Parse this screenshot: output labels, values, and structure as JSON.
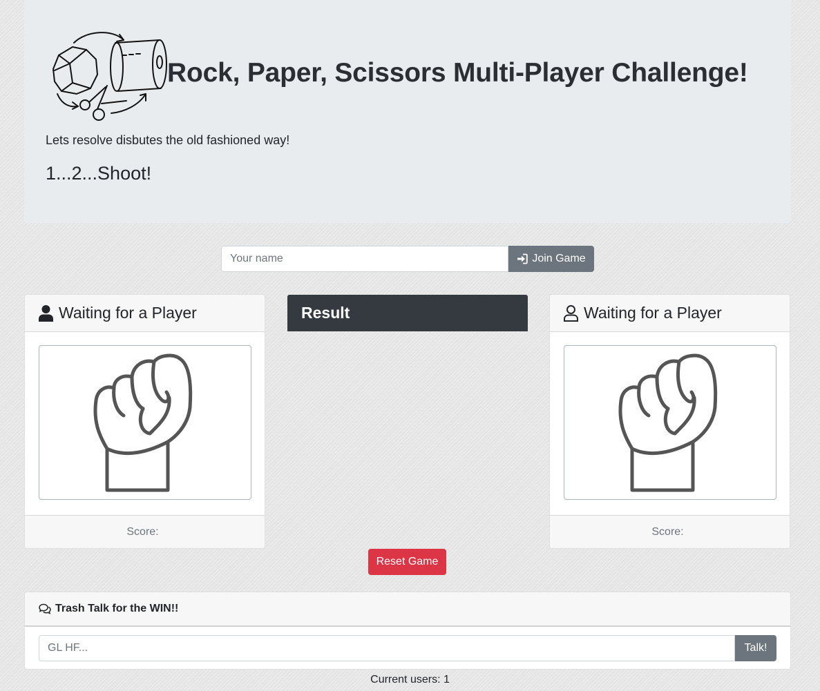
{
  "header": {
    "title": "Rock, Paper, Scissors Multi-Player Challenge!",
    "lead": "Lets resolve disbutes the old fashioned way!",
    "countdown": "1...2...Shoot!"
  },
  "join": {
    "name_placeholder": "Your name",
    "button_label": "Join Game",
    "button_icon": "sign-in-icon"
  },
  "players": [
    {
      "status": "Waiting for a Player",
      "icon": "user-solid-icon",
      "score_label": "Score:",
      "score": "",
      "hand": "fist-icon"
    },
    {
      "status": "Waiting for a Player",
      "icon": "user-outline-icon",
      "score_label": "Score:",
      "score": "",
      "hand": "fist-icon"
    }
  ],
  "result": {
    "title": "Result"
  },
  "reset": {
    "label": "Reset Game"
  },
  "chat": {
    "title": "Trash Talk for the WIN!!",
    "input_placeholder": "GL HF...",
    "button_label": "Talk!",
    "icon": "comments-icon"
  },
  "users": {
    "text": "Current users: 1"
  },
  "colors": {
    "jumbotron_bg": "#e9ecef",
    "secondary": "#6c757d",
    "danger": "#dc3545",
    "dark": "#343a40"
  }
}
